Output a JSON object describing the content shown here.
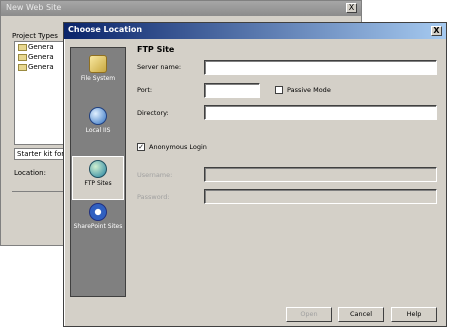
{
  "background_window": {
    "title": "New Web Site",
    "close_label": "X",
    "project_types_label": "Project Types",
    "project_items": [
      "Genera",
      "Genera",
      "Genera"
    ],
    "starter_kit_text": "Starter kit for c",
    "location_label": "Location:"
  },
  "dialog": {
    "title": "Choose Location",
    "close_label": "X",
    "nav": [
      {
        "label": "File System",
        "icon": "folder-icon"
      },
      {
        "label": "Local IIS",
        "icon": "iis-icon"
      },
      {
        "label": "FTP Sites",
        "icon": "ftp-globe-icon",
        "selected": true
      },
      {
        "label": "SharePoint Sites",
        "icon": "sharepoint-icon"
      }
    ],
    "section_title": "FTP Site",
    "server_label": "Server name:",
    "server_value": "",
    "port_label": "Port:",
    "port_value": "",
    "passive_label": "Passive Mode",
    "passive_checked": false,
    "directory_label": "Directory:",
    "directory_value": "",
    "anonymous_label": "Anonymous Login",
    "anonymous_checked": true,
    "anonymous_check_glyph": "✓",
    "username_label": "Username:",
    "username_value": "",
    "password_label": "Password:",
    "password_value": "",
    "buttons": {
      "open": "Open",
      "cancel": "Cancel",
      "help": "Help"
    }
  }
}
